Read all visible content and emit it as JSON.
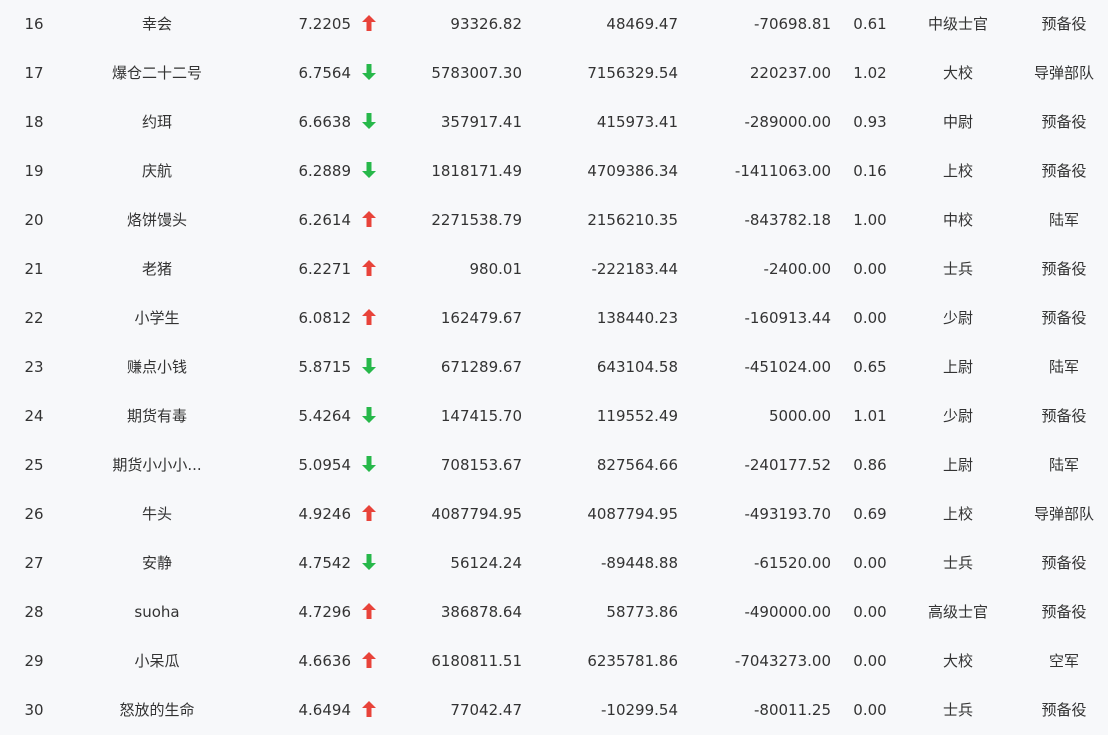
{
  "colors": {
    "up": "#e8433a",
    "down": "#27b84a",
    "text": "#333333",
    "background": "#f7f8fa"
  },
  "rows": [
    {
      "rank": "16",
      "name": "幸会",
      "score": "7.2205",
      "trend": "up",
      "v1": "93326.82",
      "v2": "48469.47",
      "v3": "-70698.81",
      "ratio": "0.61",
      "title": "中级士官",
      "branch": "预备役"
    },
    {
      "rank": "17",
      "name": "爆仓二十二号",
      "score": "6.7564",
      "trend": "down",
      "v1": "5783007.30",
      "v2": "7156329.54",
      "v3": "220237.00",
      "ratio": "1.02",
      "title": "大校",
      "branch": "导弹部队"
    },
    {
      "rank": "18",
      "name": "约珥",
      "score": "6.6638",
      "trend": "down",
      "v1": "357917.41",
      "v2": "415973.41",
      "v3": "-289000.00",
      "ratio": "0.93",
      "title": "中尉",
      "branch": "预备役"
    },
    {
      "rank": "19",
      "name": "庆航",
      "score": "6.2889",
      "trend": "down",
      "v1": "1818171.49",
      "v2": "4709386.34",
      "v3": "-1411063.00",
      "ratio": "0.16",
      "title": "上校",
      "branch": "预备役"
    },
    {
      "rank": "20",
      "name": "烙饼馒头",
      "score": "6.2614",
      "trend": "up",
      "v1": "2271538.79",
      "v2": "2156210.35",
      "v3": "-843782.18",
      "ratio": "1.00",
      "title": "中校",
      "branch": "陆军"
    },
    {
      "rank": "21",
      "name": "老猪",
      "score": "6.2271",
      "trend": "up",
      "v1": "980.01",
      "v2": "-222183.44",
      "v3": "-2400.00",
      "ratio": "0.00",
      "title": "士兵",
      "branch": "预备役"
    },
    {
      "rank": "22",
      "name": "小学生",
      "score": "6.0812",
      "trend": "up",
      "v1": "162479.67",
      "v2": "138440.23",
      "v3": "-160913.44",
      "ratio": "0.00",
      "title": "少尉",
      "branch": "预备役"
    },
    {
      "rank": "23",
      "name": "赚点小钱",
      "score": "5.8715",
      "trend": "down",
      "v1": "671289.67",
      "v2": "643104.58",
      "v3": "-451024.00",
      "ratio": "0.65",
      "title": "上尉",
      "branch": "陆军"
    },
    {
      "rank": "24",
      "name": "期货有毒",
      "score": "5.4264",
      "trend": "down",
      "v1": "147415.70",
      "v2": "119552.49",
      "v3": "5000.00",
      "ratio": "1.01",
      "title": "少尉",
      "branch": "预备役"
    },
    {
      "rank": "25",
      "name": "期货小小小...",
      "score": "5.0954",
      "trend": "down",
      "v1": "708153.67",
      "v2": "827564.66",
      "v3": "-240177.52",
      "ratio": "0.86",
      "title": "上尉",
      "branch": "陆军"
    },
    {
      "rank": "26",
      "name": "牛头",
      "score": "4.9246",
      "trend": "up",
      "v1": "4087794.95",
      "v2": "4087794.95",
      "v3": "-493193.70",
      "ratio": "0.69",
      "title": "上校",
      "branch": "导弹部队"
    },
    {
      "rank": "27",
      "name": "安静",
      "score": "4.7542",
      "trend": "down",
      "v1": "56124.24",
      "v2": "-89448.88",
      "v3": "-61520.00",
      "ratio": "0.00",
      "title": "士兵",
      "branch": "预备役"
    },
    {
      "rank": "28",
      "name": "suoha",
      "score": "4.7296",
      "trend": "up",
      "v1": "386878.64",
      "v2": "58773.86",
      "v3": "-490000.00",
      "ratio": "0.00",
      "title": "高级士官",
      "branch": "预备役"
    },
    {
      "rank": "29",
      "name": "小呆瓜",
      "score": "4.6636",
      "trend": "up",
      "v1": "6180811.51",
      "v2": "6235781.86",
      "v3": "-7043273.00",
      "ratio": "0.00",
      "title": "大校",
      "branch": "空军"
    },
    {
      "rank": "30",
      "name": "怒放的生命",
      "score": "4.6494",
      "trend": "up",
      "v1": "77042.47",
      "v2": "-10299.54",
      "v3": "-80011.25",
      "ratio": "0.00",
      "title": "士兵",
      "branch": "预备役"
    }
  ]
}
